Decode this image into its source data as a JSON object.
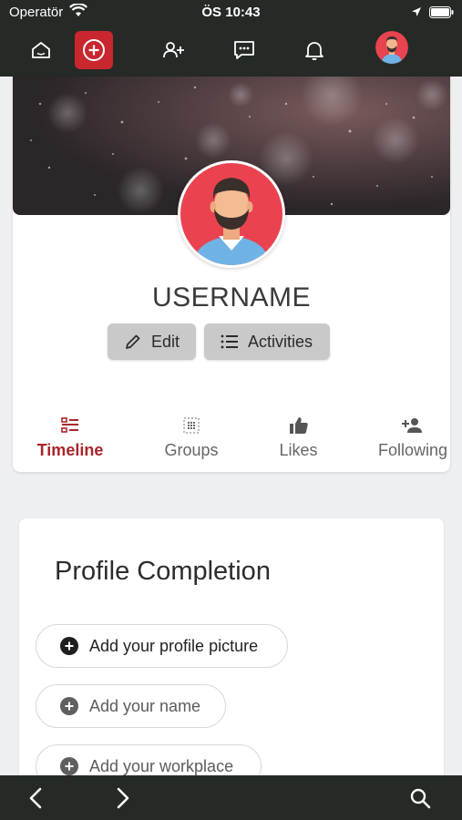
{
  "status_bar": {
    "carrier": "Operatör",
    "time": "ÖS 10:43"
  },
  "top_nav": {
    "icons": [
      "home-icon",
      "add-circle-icon",
      "add-user-icon",
      "chat-icon",
      "bell-icon",
      "avatar"
    ],
    "accent": "#c9272e",
    "bar_color": "#252a26"
  },
  "profile": {
    "username": "USERNAME",
    "edit_label": "Edit",
    "activities_label": "Activities"
  },
  "tabs": [
    {
      "label": "Timeline",
      "icon": "timeline-icon",
      "active": true
    },
    {
      "label": "Groups",
      "icon": "groups-icon",
      "active": false
    },
    {
      "label": "Likes",
      "icon": "thumbs-up-icon",
      "active": false
    },
    {
      "label": "Following",
      "icon": "follow-user-icon",
      "active": false
    }
  ],
  "completion": {
    "title": "Profile Completion",
    "items": [
      {
        "label": "Add your profile picture"
      },
      {
        "label": "Add your name"
      },
      {
        "label": "Add your workplace"
      }
    ]
  },
  "bottom_bar": {
    "icons": [
      "back-icon",
      "forward-icon",
      "search-icon"
    ]
  }
}
